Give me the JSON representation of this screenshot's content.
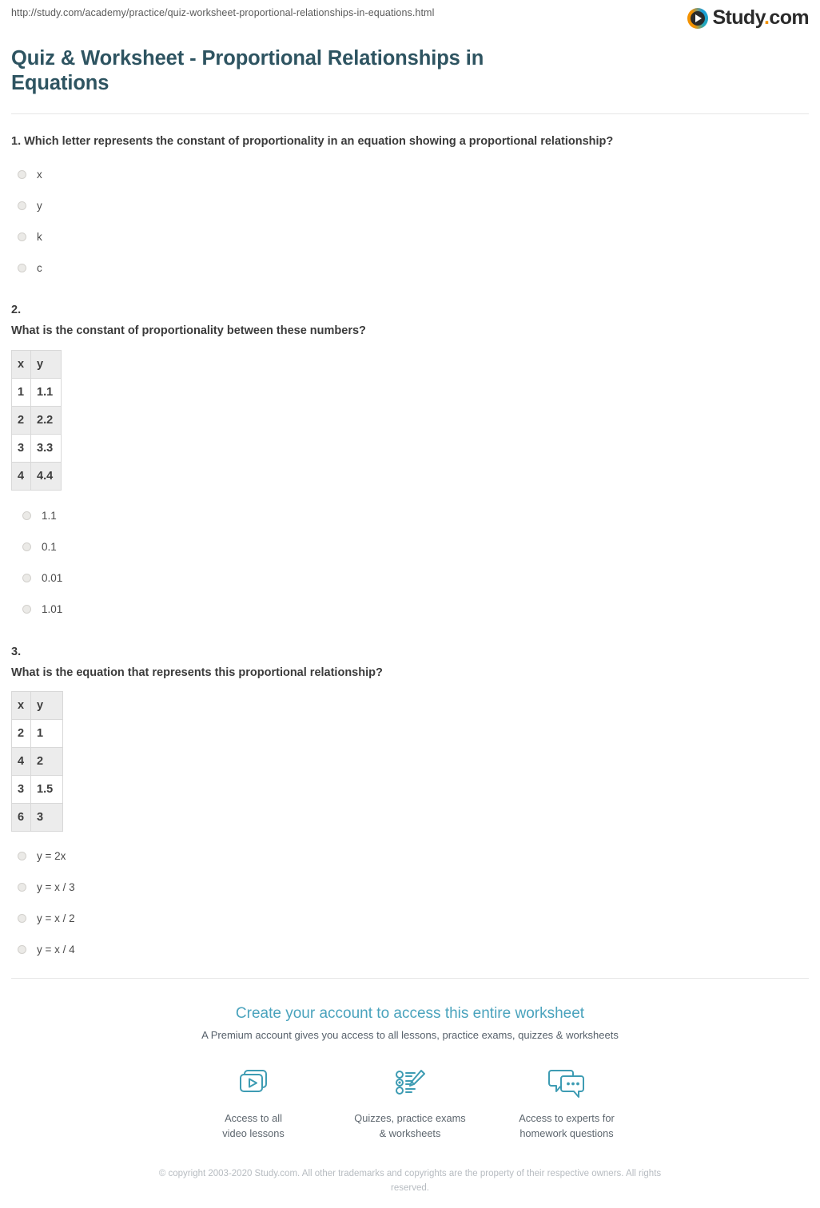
{
  "browser": {
    "url": "http://study.com/academy/practice/quiz-worksheet-proportional-relationships-in-equations.html"
  },
  "brand": {
    "name": "Study",
    "dot": ".",
    "tld": "com",
    "logo_icon": "play-circle-icon",
    "accent_orange": "#f39200",
    "accent_blue": "#1b9dd9"
  },
  "header": {
    "title": "Quiz & Worksheet - Proportional Relationships in Equations",
    "title_color": "#2e5461"
  },
  "questions": [
    {
      "number": "1.",
      "inline_number": true,
      "text": "Which letter represents the constant of proportionality in an equation showing a proportional relationship?",
      "options": [
        "x",
        "y",
        "k",
        "c"
      ]
    },
    {
      "number": "2.",
      "inline_number": false,
      "text": "What is the constant of proportionality between these numbers?",
      "table": {
        "headers": [
          "x",
          "y"
        ],
        "rows": [
          [
            "1",
            "1.1"
          ],
          [
            "2",
            "2.2"
          ],
          [
            "3",
            "3.3"
          ],
          [
            "4",
            "4.4"
          ]
        ]
      },
      "options": [
        "1.1",
        "0.1",
        "0.01",
        "1.01"
      ]
    },
    {
      "number": "3.",
      "inline_number": false,
      "text": "What is the equation that represents this proportional relationship?",
      "table": {
        "headers": [
          "x",
          "y"
        ],
        "rows": [
          [
            "2",
            "1"
          ],
          [
            "4",
            "2"
          ],
          [
            "3",
            "1.5"
          ],
          [
            "6",
            "3"
          ]
        ]
      },
      "options": [
        "y = 2x",
        "y = x / 3",
        "y = x / 2",
        "y = x / 4"
      ]
    }
  ],
  "cta": {
    "title": "Create your account to access this entire worksheet",
    "title_color": "#4aa3bd",
    "subtitle": "A Premium account gives you access to all lessons, practice exams, quizzes & worksheets",
    "features": [
      {
        "icon": "video-lessons-icon",
        "label": "Access to all\nvideo lessons"
      },
      {
        "icon": "quiz-checklist-pencil-icon",
        "label": "Quizzes, practice exams\n& worksheets"
      },
      {
        "icon": "chat-bubbles-icon",
        "label": "Access to experts for\nhomework questions"
      }
    ]
  },
  "footer": {
    "copyright": "© copyright 2003-2020 Study.com. All other trademarks and copyrights are the property of their respective owners. All rights reserved."
  }
}
